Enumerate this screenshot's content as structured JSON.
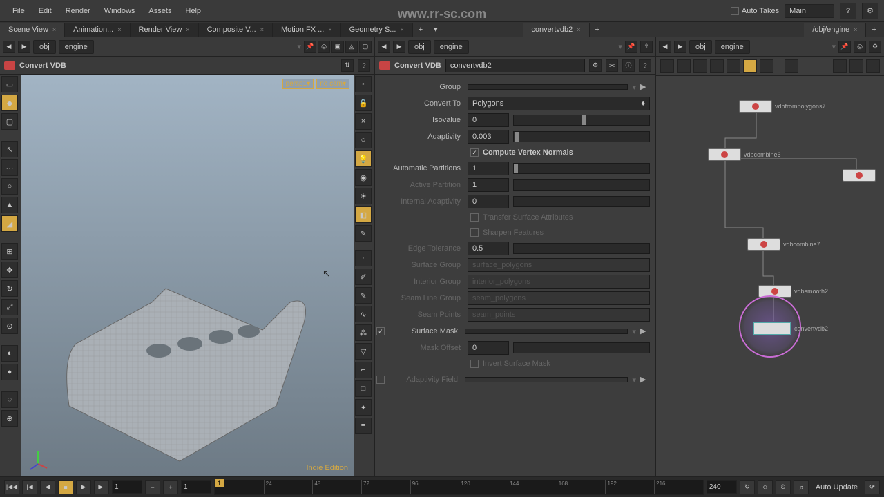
{
  "menubar": {
    "file": "File",
    "edit": "Edit",
    "render": "Render",
    "windows": "Windows",
    "assets": "Assets",
    "help": "Help",
    "auto_takes": "Auto Takes",
    "main": "Main"
  },
  "watermark": "www.rr-sc.com",
  "tabs": {
    "scene_view": "Scene View",
    "animation": "Animation...",
    "render_view": "Render View",
    "composite": "Composite V...",
    "motion_fx": "Motion FX ...",
    "geometry": "Geometry S..."
  },
  "path": {
    "obj": "obj",
    "engine": "engine"
  },
  "viewport": {
    "title": "Convert VDB",
    "persp": "persp1▾",
    "cam": "no cam▾",
    "indie": "Indie Edition"
  },
  "param_tab": "convertvdb2",
  "params": {
    "title": "Convert VDB",
    "node_name": "convertvdb2",
    "group_label": "Group",
    "convert_to_label": "Convert To",
    "convert_to": "Polygons",
    "isovalue_label": "Isovalue",
    "isovalue": "0",
    "adaptivity_label": "Adaptivity",
    "adaptivity": "0.003",
    "compute_normals": "Compute Vertex Normals",
    "auto_partitions_label": "Automatic Partitions",
    "auto_partitions": "1",
    "active_partition_label": "Active Partition",
    "active_partition": "1",
    "internal_adapt_label": "Internal Adaptivity",
    "internal_adapt": "0",
    "transfer_attrs": "Transfer Surface Attributes",
    "sharpen": "Sharpen Features",
    "edge_tol_label": "Edge Tolerance",
    "edge_tol": "0.5",
    "surface_group_label": "Surface Group",
    "surface_group": "surface_polygons",
    "interior_group_label": "Interior Group",
    "interior_group": "interior_polygons",
    "seam_line_label": "Seam Line Group",
    "seam_line": "seam_polygons",
    "seam_points_label": "Seam Points",
    "seam_points": "seam_points",
    "surface_mask_label": "Surface Mask",
    "mask_offset_label": "Mask Offset",
    "mask_offset": "0",
    "invert_mask": "Invert Surface Mask",
    "adaptivity_field_label": "Adaptivity Field"
  },
  "network_tab": "/obj/engine",
  "nodes": {
    "n1": "vdbfrompolygons7",
    "n2": "vdbcombine6",
    "n3": "",
    "n4": "vdbcombine7",
    "n5": "vdbsmooth2",
    "n6": "convertvdb2"
  },
  "timeline": {
    "frame_1": "1",
    "start": "1",
    "cur": "1",
    "ticks": [
      "24",
      "48",
      "72",
      "96",
      "120",
      "144",
      "168",
      "192",
      "216"
    ],
    "end_field": "240",
    "end": "240",
    "auto_update": "Auto Update"
  }
}
